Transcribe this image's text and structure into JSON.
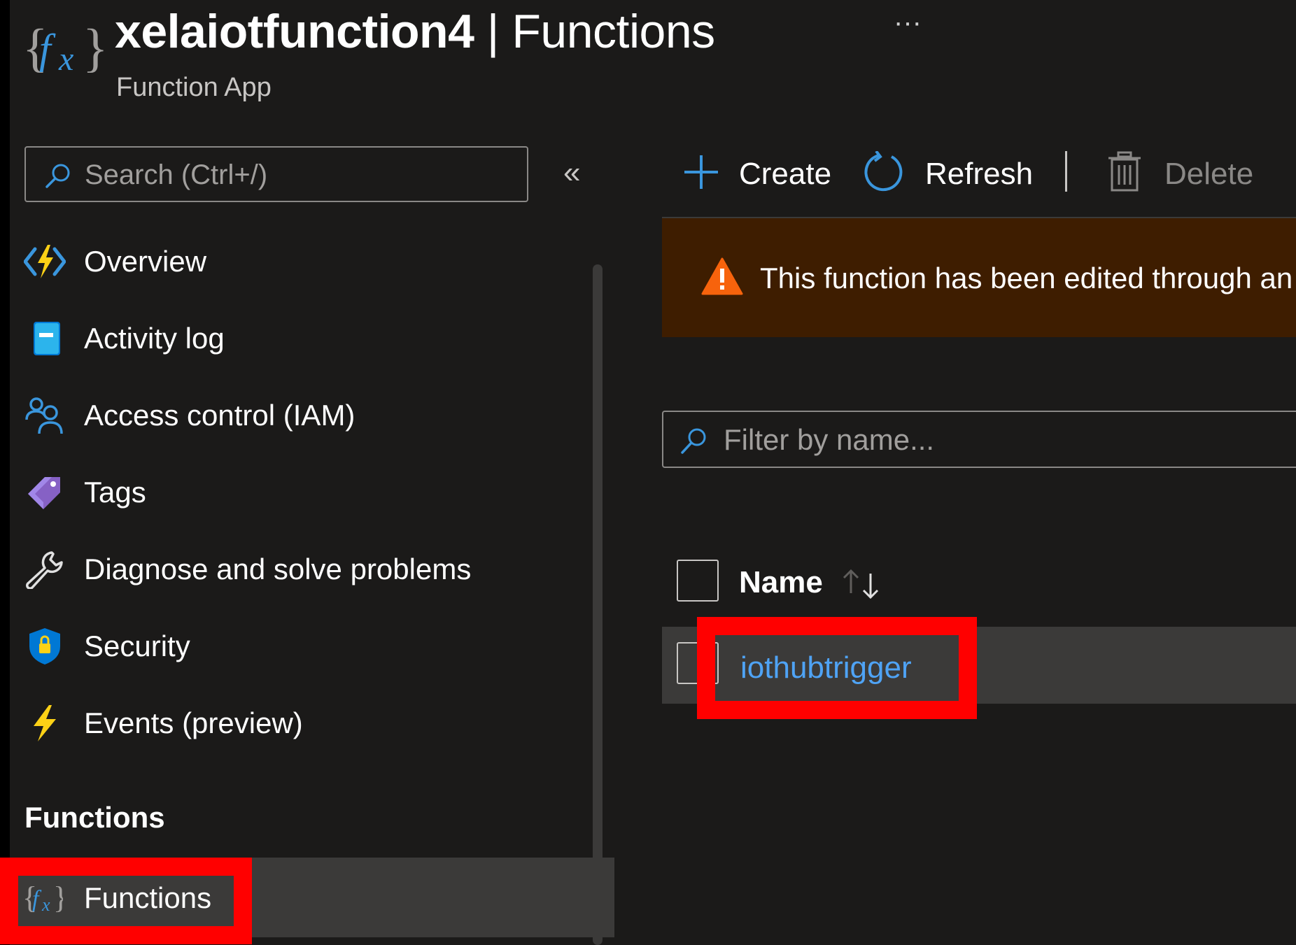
{
  "header": {
    "title_name": "xelaiotfunction4",
    "title_separator": "|",
    "title_section": "Functions",
    "subtitle": "Function App",
    "more_label": "···"
  },
  "sidebar": {
    "search_placeholder": "Search (Ctrl+/)",
    "collapse_label": "«",
    "items": [
      {
        "label": "Overview",
        "icon": "function-bolt-icon"
      },
      {
        "label": "Activity log",
        "icon": "activity-log-icon"
      },
      {
        "label": "Access control (IAM)",
        "icon": "users-icon"
      },
      {
        "label": "Tags",
        "icon": "tag-icon"
      },
      {
        "label": "Diagnose and solve problems",
        "icon": "wrench-icon"
      },
      {
        "label": "Security",
        "icon": "shield-icon"
      },
      {
        "label": "Events (preview)",
        "icon": "lightning-icon"
      }
    ],
    "section_title": "Functions",
    "selected_item": {
      "label": "Functions",
      "icon": "function-fx-icon"
    }
  },
  "toolbar": {
    "create_label": "Create",
    "refresh_label": "Refresh",
    "delete_label": "Delete"
  },
  "banner": {
    "message": "This function has been edited through an e"
  },
  "filter": {
    "placeholder": "Filter by name..."
  },
  "table": {
    "column_name": "Name",
    "rows": [
      {
        "name": "iothubtrigger"
      }
    ]
  },
  "colors": {
    "background": "#1b1a19",
    "accent": "#0078d4",
    "link": "#4fa3f5",
    "highlight": "#ff0000",
    "warning_bg": "#3e1d00",
    "warning_icon": "#f7630c"
  }
}
